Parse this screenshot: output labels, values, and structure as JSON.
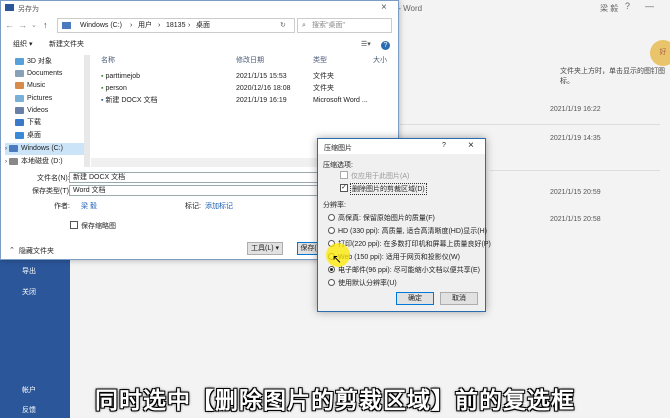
{
  "backstage": {
    "doc_title": "文档 - Word",
    "user": "梁 毅",
    "nav": [
      "导出",
      "关闭",
      "帐户",
      "反馈"
    ],
    "info_text": "文件夹上方时，单击显示的图钉图标。",
    "avatar_text": "好",
    "dates": [
      "2021/1/19 16:22",
      "2021/1/19 14:35",
      "2021/1/15 20:59",
      "2021/1/15 20:58"
    ]
  },
  "saveas": {
    "title": "另存为",
    "path": [
      "Windows (C:)",
      "用户",
      "18135",
      "桌面"
    ],
    "search_placeholder": "搜索\"桌面\"",
    "organize": "组织 ▾",
    "new_folder": "新建文件夹",
    "nav_items": [
      "3D 对象",
      "Documents",
      "Music",
      "Pictures",
      "Videos",
      "下载",
      "桌面",
      "Windows (C:)",
      "本地磁盘 (D:)"
    ],
    "columns": {
      "name": "名称",
      "date": "修改日期",
      "type": "类型",
      "size": "大小"
    },
    "files": [
      {
        "name": "parttimejob",
        "date": "2021/1/15 15:53",
        "type": "文件夹"
      },
      {
        "name": "person",
        "date": "2020/12/16 18:08",
        "type": "文件夹"
      },
      {
        "name": "新建 DOCX 文档",
        "date": "2021/1/19 16:19",
        "type": "Microsoft Word ..."
      }
    ],
    "filename_label": "文件名(N):",
    "filename_value": "新建 DOCX 文档",
    "savetype_label": "保存类型(T):",
    "savetype_value": "Word 文档",
    "author_label": "作者:",
    "author_value": "梁 毅",
    "tag_label": "标记:",
    "tag_value": "添加标记",
    "thumb_label": "保存缩略图",
    "hide_folders": "隐藏文件夹",
    "tools": "工具(L)",
    "save": "保存(S)"
  },
  "compress": {
    "title": "压缩图片",
    "help": "?",
    "options_label": "压缩选项:",
    "opt_apply_only": "仅应用于此图片(A)",
    "opt_delete_crop": "删除图片的剪裁区域(D)",
    "resolution_label": "分辨率:",
    "resolutions": [
      "高保真: 保留原始图片的质量(F)",
      "HD (330 ppi): 高质量, 适合高清晰度(HD)显示(H)",
      "打印(220 ppi): 在多数打印机和屏幕上质量良好(P)",
      "Web (150 ppi): 适用于网页和投影仪(W)",
      "电子邮件(96 ppi): 尽可能缩小文档以便共享(E)",
      "使用默认分辨率(U)"
    ],
    "ok": "确定",
    "cancel": "取消"
  },
  "caption": "同时选中【删除图片的剪裁区域】前的复选框"
}
